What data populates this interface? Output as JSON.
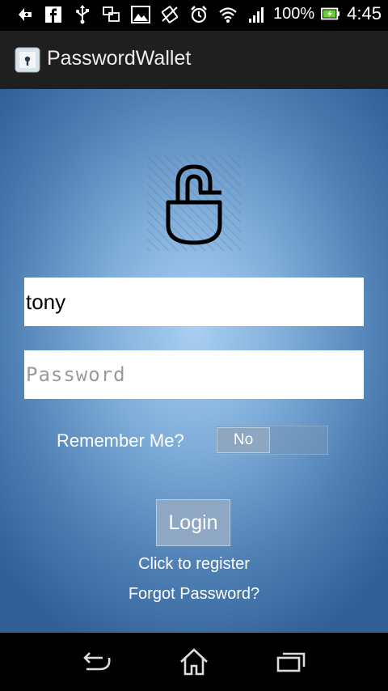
{
  "status_bar": {
    "icons": [
      "add-icon",
      "facebook-icon",
      "usb-icon",
      "screens-icon",
      "image-icon",
      "vibrate-icon",
      "alarm-icon",
      "wifi-icon",
      "signal-icon",
      "battery-icon"
    ],
    "battery_percent": "100%",
    "time": "4:45"
  },
  "action_bar": {
    "title": "PasswordWallet",
    "app_icon": "lock-app-icon"
  },
  "login": {
    "username_value": "tony",
    "password_placeholder": "Password",
    "remember_label": "Remember Me?",
    "remember_toggle_value": "No",
    "login_button": "Login",
    "register_link": "Click to register",
    "forgot_link": "Forgot Password?"
  },
  "nav_bar": {
    "buttons": [
      "back-icon",
      "home-icon",
      "recents-icon"
    ]
  },
  "colors": {
    "gradient_center": "#a9cff2",
    "gradient_edge": "#2f5f95",
    "action_bar_bg": "#1f1f1f"
  }
}
